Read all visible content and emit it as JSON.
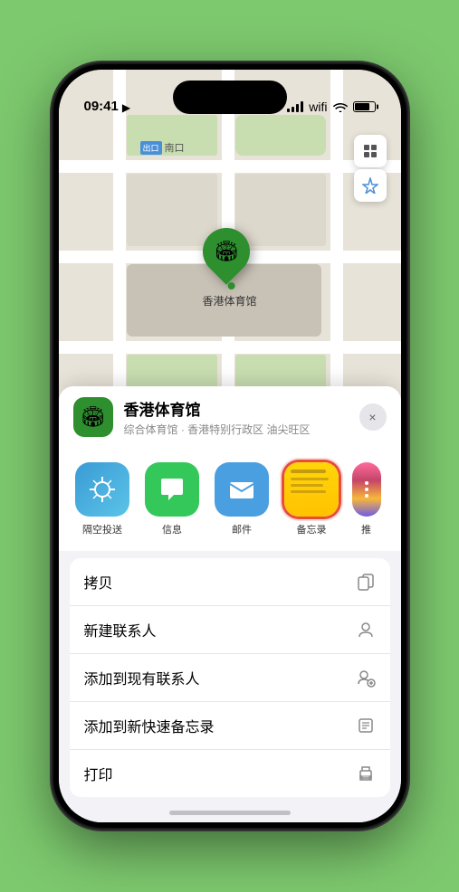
{
  "status_bar": {
    "time": "09:41",
    "location_arrow": "▶"
  },
  "map": {
    "label_prefix": "出口",
    "label_text": "南口",
    "pin_label": "香港体育馆"
  },
  "map_controls": {
    "layers_icon": "🗺",
    "location_icon": "➤"
  },
  "location_card": {
    "name": "香港体育馆",
    "subtitle": "综合体育馆 · 香港特别行政区 油尖旺区",
    "close_label": "×"
  },
  "share_items": [
    {
      "id": "airdrop",
      "label": "隔空投送",
      "type": "airdrop"
    },
    {
      "id": "message",
      "label": "信息",
      "type": "message"
    },
    {
      "id": "mail",
      "label": "邮件",
      "type": "mail"
    },
    {
      "id": "notes",
      "label": "备忘录",
      "type": "notes",
      "selected": true
    },
    {
      "id": "more",
      "label": "推",
      "type": "more"
    }
  ],
  "actions": [
    {
      "id": "copy",
      "label": "拷贝",
      "icon": "📋"
    },
    {
      "id": "new-contact",
      "label": "新建联系人",
      "icon": "👤"
    },
    {
      "id": "add-contact",
      "label": "添加到现有联系人",
      "icon": "👤+"
    },
    {
      "id": "quick-note",
      "label": "添加到新快速备忘录",
      "icon": "📝"
    },
    {
      "id": "print",
      "label": "打印",
      "icon": "🖨"
    }
  ]
}
